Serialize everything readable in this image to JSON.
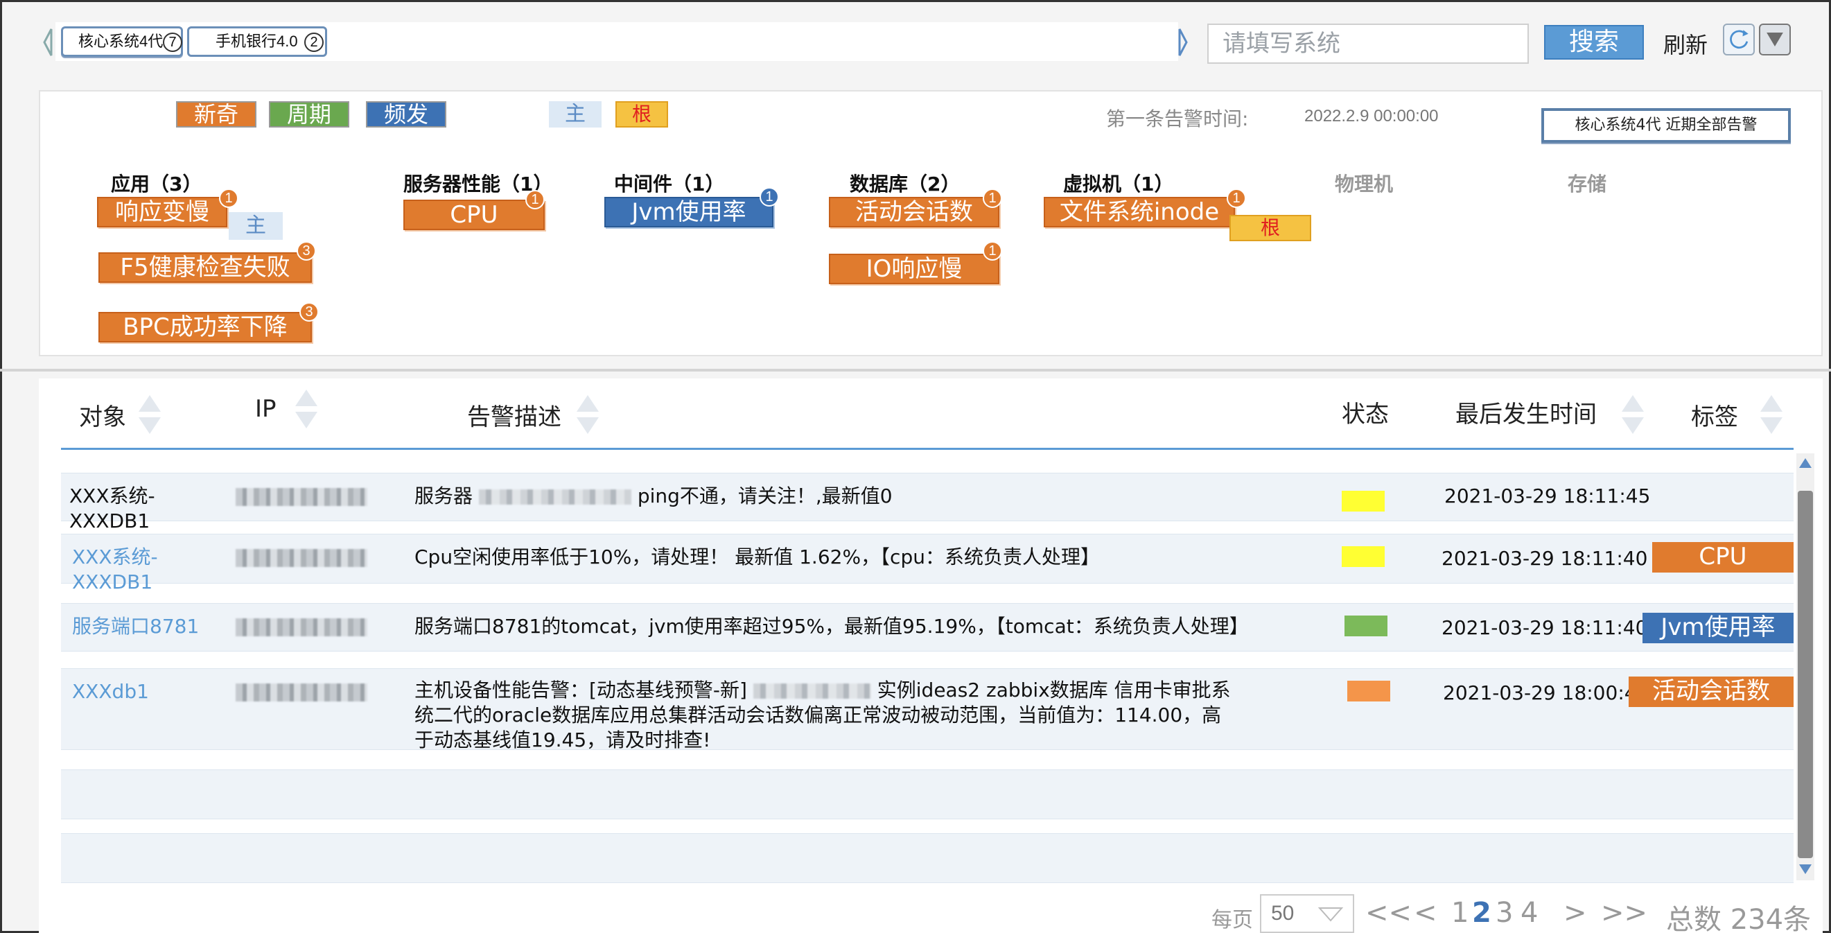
{
  "tabs": [
    {
      "label": "核心系统4代",
      "count": "7"
    },
    {
      "label": "手机银行4.0",
      "count": "2"
    }
  ],
  "search": {
    "placeholder": "请填写系统",
    "button": "搜索"
  },
  "refresh_label": "刷新",
  "legend": [
    {
      "label": "新奇",
      "color": "#e07b2e"
    },
    {
      "label": "周期",
      "color": "#6aa84f"
    },
    {
      "label": "频发",
      "color": "#3d72b4"
    }
  ],
  "tag_main": "主",
  "tag_root": "根",
  "first_alert": {
    "label": "第一条告警时间:",
    "value": "2022.2.9 00:00:00"
  },
  "recent_button": "核心系统4代   近期全部告警",
  "categories": [
    {
      "title": "应用（3）",
      "metrics": [
        {
          "label": "响应变慢",
          "count": "1"
        },
        {
          "label": "F5健康检查失败",
          "count": "3"
        },
        {
          "label": "BPC成功率下降",
          "count": "3"
        }
      ]
    },
    {
      "title": "服务器性能（1）",
      "metrics": [
        {
          "label": "CPU",
          "count": "1"
        }
      ]
    },
    {
      "title": "中间件（1）",
      "metrics": [
        {
          "label": "Jvm使用率",
          "count": "1"
        }
      ]
    },
    {
      "title": "数据库（2）",
      "metrics": [
        {
          "label": "活动会话数",
          "count": "1"
        },
        {
          "label": "IO响应慢",
          "count": "1"
        }
      ]
    },
    {
      "title": "虚拟机（1）",
      "metrics": [
        {
          "label": "文件系统inode",
          "count": "1"
        }
      ]
    },
    {
      "title": "物理机",
      "metrics": []
    },
    {
      "title": "存储",
      "metrics": []
    }
  ],
  "table": {
    "columns": [
      "对象",
      "IP",
      "告警描述",
      "状态",
      "最后发生时间",
      "标签"
    ],
    "rows": [
      {
        "object": "XXX系统-XXXDB1",
        "desc_prefix": "服务器",
        "desc_suffix": "ping不通，请关注！,最新值0",
        "status_color": "#ffff33",
        "time": "2021-03-29 18:11:45",
        "tag": ""
      },
      {
        "object": "XXX系统-XXXDB1",
        "desc": "Cpu空闲使用率低于10%，请处理！  最新值 1.62%，【cpu：系统负责人处理】",
        "status_color": "#ffff33",
        "time": "2021-03-29 18:11:40",
        "tag": "CPU"
      },
      {
        "object": "服务端口8781",
        "desc": "服务端口8781的tomcat，jvm使用率超过95%，最新值95.19%，【tomcat：系统负责人处理】",
        "status_color": "#7cba5a",
        "time": "2021-03-29 18:11:40",
        "tag": "Jvm使用率"
      },
      {
        "object": "XXXdb1",
        "desc_line1_prefix": "主机设备性能告警：[动态基线预警-新]",
        "desc_line1_suffix": "实例ideas2 zabbix数据库 信用卡审批系",
        "desc_line2": "统二代的oracle数据库应用总集群活动会话数偏离正常波动被动范围，当前值为：114.00，高",
        "desc_line3": "于动态基线值19.45，请及时排查!",
        "status_color": "#f4954a",
        "time": "2021-03-29 18:00:4",
        "tag": "活动会话数"
      }
    ]
  },
  "pagination": {
    "per_page_label": "每页",
    "per_page_value": "50",
    "first": "<<",
    "prev": "<",
    "pages": [
      "1",
      "2",
      "3",
      "4"
    ],
    "current_page": "2",
    "next": ">",
    "last": ">>",
    "total": "总数 234条"
  }
}
